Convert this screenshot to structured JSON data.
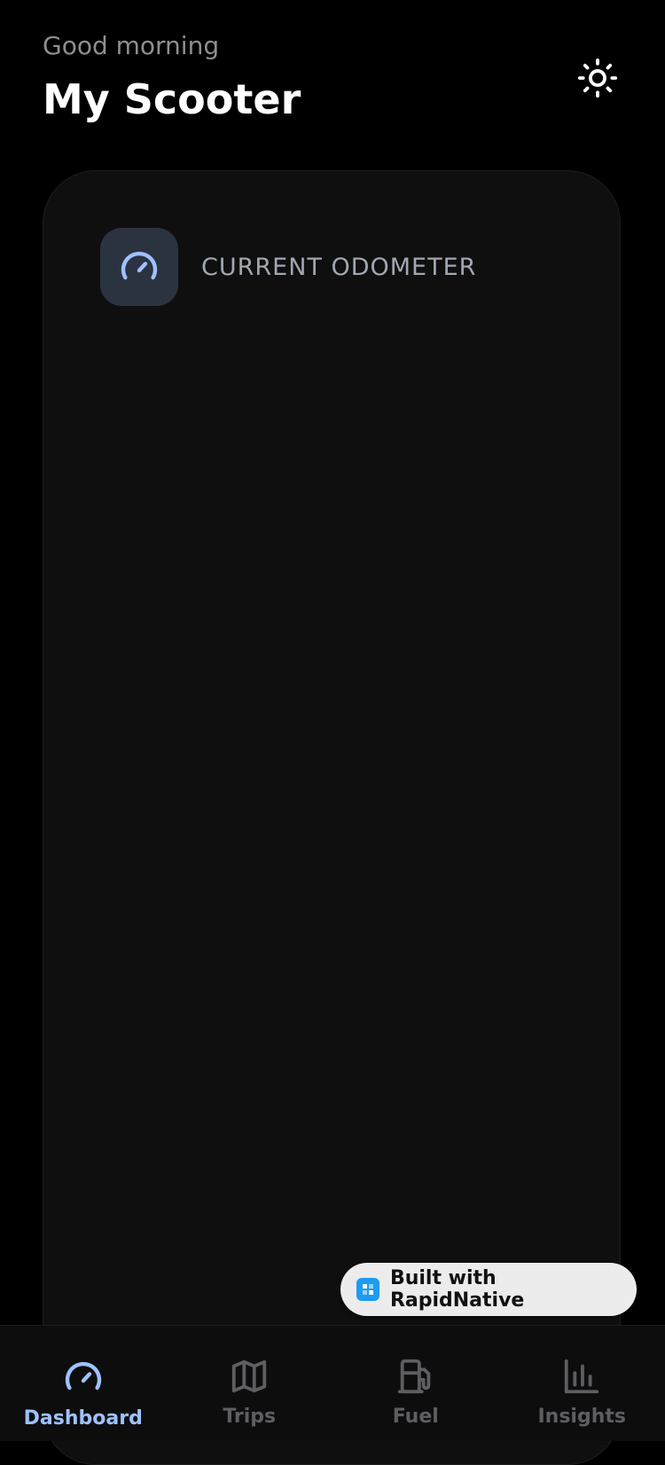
{
  "header": {
    "greeting": "Good morning",
    "title": "My Scooter",
    "theme_icon": "sun-icon"
  },
  "card": {
    "odometer_label": "CURRENT ODOMETER",
    "icon": "speedometer-icon"
  },
  "badge": {
    "text": "Built with RapidNative",
    "icon": "rapidnative-logo-icon"
  },
  "tabs": [
    {
      "label": "Dashboard",
      "icon": "speedometer-icon",
      "active": true
    },
    {
      "label": "Trips",
      "icon": "map-icon",
      "active": false
    },
    {
      "label": "Fuel",
      "icon": "fuel-pump-icon",
      "active": false
    },
    {
      "label": "Insights",
      "icon": "bar-chart-icon",
      "active": false
    }
  ],
  "colors": {
    "accent": "#9ec1ff",
    "inactive": "#5e5e62",
    "card": "#0f0f0f",
    "icon_box": "#2c3340",
    "background": "#000000"
  }
}
